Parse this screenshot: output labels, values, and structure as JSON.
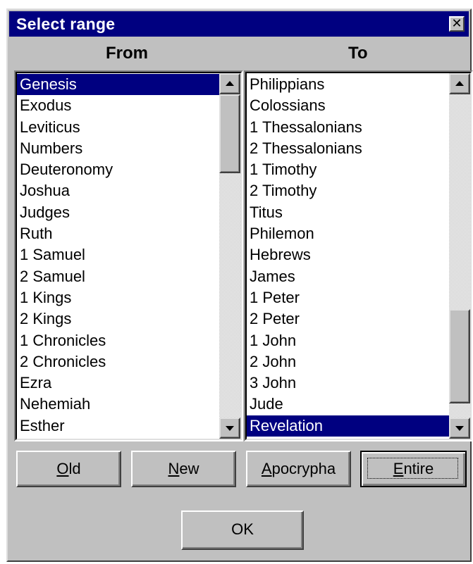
{
  "dialog": {
    "title": "Select range",
    "close_symbol": "✕"
  },
  "from": {
    "label": "From",
    "items": [
      "Genesis",
      "Exodus",
      "Leviticus",
      "Numbers",
      "Deuteronomy",
      "Joshua",
      "Judges",
      "Ruth",
      "1 Samuel",
      "2 Samuel",
      "1 Kings",
      "2 Kings",
      "1 Chronicles",
      "2 Chronicles",
      "Ezra",
      "Nehemiah",
      "Esther"
    ],
    "selected": "Genesis"
  },
  "to": {
    "label": "To",
    "items": [
      "Philippians",
      "Colossians",
      "1 Thessalonians",
      "2 Thessalonians",
      "1 Timothy",
      "2 Timothy",
      "Titus",
      "Philemon",
      "Hebrews",
      "James",
      "1 Peter",
      "2 Peter",
      "1 John",
      "2 John",
      "3 John",
      "Jude",
      "Revelation"
    ],
    "selected": "Revelation"
  },
  "buttons": {
    "old": {
      "accel": "O",
      "rest": "ld"
    },
    "new": {
      "accel": "N",
      "rest": "ew"
    },
    "apocrypha": {
      "accel": "A",
      "rest": "pocrypha"
    },
    "entire": {
      "accel": "E",
      "rest": "ntire"
    },
    "ok": "OK"
  },
  "colors": {
    "titlebar": "#000080",
    "selection": "#000080",
    "face": "#c0c0c0"
  },
  "icons": {
    "close": "close-icon",
    "scroll_up": "up-arrow-icon",
    "scroll_down": "down-arrow-icon"
  }
}
